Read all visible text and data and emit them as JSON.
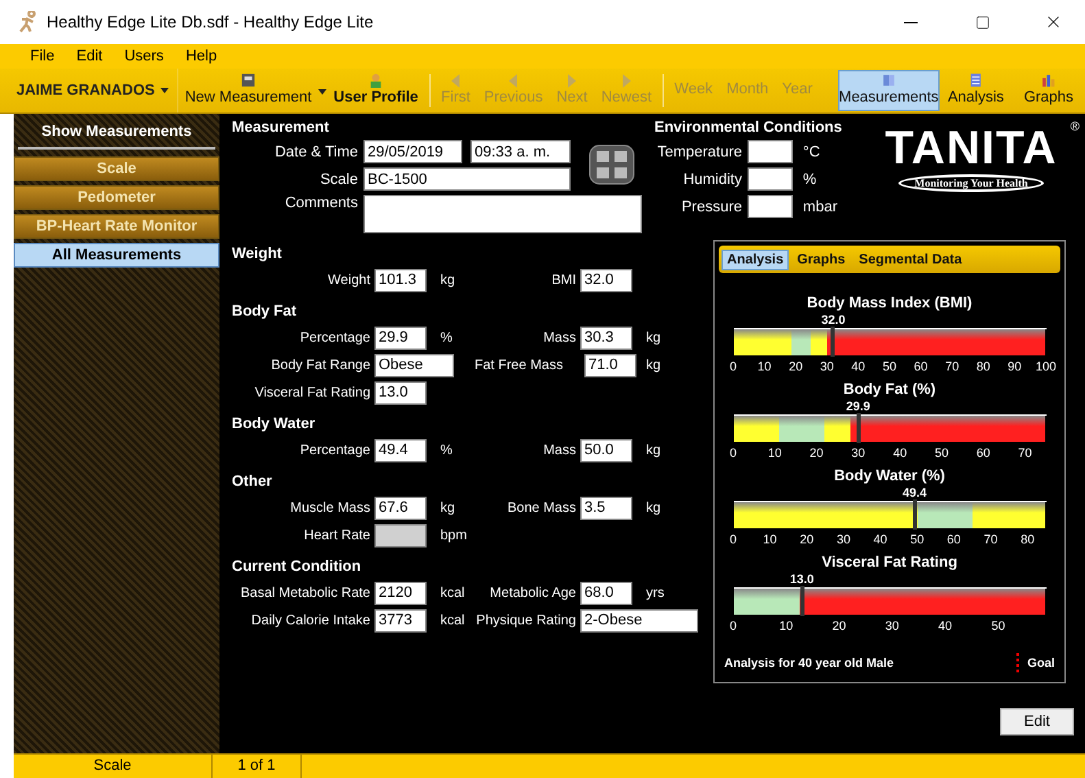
{
  "window": {
    "title": "Healthy Edge Lite Db.sdf - Healthy Edge Lite"
  },
  "menu": [
    "File",
    "Edit",
    "Users",
    "Help"
  ],
  "toolbar": {
    "user": "JAIME GRANADOS",
    "new_measurement": "New Measurement",
    "user_profile": "User Profile",
    "nav": [
      {
        "label": "First",
        "disabled": true
      },
      {
        "label": "Previous",
        "disabled": true
      },
      {
        "label": "Next",
        "disabled": true
      },
      {
        "label": "Newest",
        "disabled": true
      }
    ],
    "periods": [
      {
        "label": "Week",
        "disabled": true
      },
      {
        "label": "Month",
        "disabled": true
      },
      {
        "label": "Year",
        "disabled": true
      }
    ],
    "views": [
      {
        "label": "Measurements",
        "kind": "book",
        "selected": true
      },
      {
        "label": "Analysis",
        "kind": "sheet",
        "selected": false
      },
      {
        "label": "Graphs",
        "kind": "bars",
        "selected": false
      }
    ]
  },
  "sidebar": {
    "title": "Show Measurements",
    "items": [
      {
        "label": "Scale",
        "selected": false
      },
      {
        "label": "Pedometer",
        "selected": false
      },
      {
        "label": "BP-Heart Rate Monitor",
        "selected": false
      },
      {
        "label": "All Measurements",
        "selected": true
      }
    ]
  },
  "measurement": {
    "title": "Measurement",
    "date_label": "Date & Time",
    "date": "29/05/2019",
    "time": "09:33 a. m.",
    "scale_label": "Scale",
    "scale": "BC-1500",
    "comments_label": "Comments"
  },
  "environment": {
    "title": "Environmental Conditions",
    "fields": [
      {
        "label": "Temperature",
        "unit": "°C"
      },
      {
        "label": "Humidity",
        "unit": "%"
      },
      {
        "label": "Pressure",
        "unit": "mbar"
      }
    ]
  },
  "logo": {
    "brand": "TANITA",
    "mark": "®",
    "tagline": "Monitoring Your Health"
  },
  "sections": [
    {
      "title": "Weight",
      "rows": [
        [
          {
            "label": "Weight",
            "value": "101.3",
            "unit": "kg",
            "kind": "text"
          },
          {
            "label": "BMI",
            "value": "32.0",
            "kind": "text"
          }
        ]
      ]
    },
    {
      "title": "Body Fat",
      "rows": [
        [
          {
            "label": "Percentage",
            "value": "29.9",
            "unit": "%",
            "kind": "text"
          },
          {
            "label": "Mass",
            "value": "30.3",
            "unit": "kg",
            "kind": "text"
          }
        ],
        [
          {
            "label": "Body Fat Range",
            "value": "Obese",
            "kind": "wide"
          },
          {
            "label": "Fat Free Mass",
            "value": "71.0",
            "unit": "kg",
            "kind": "text"
          }
        ],
        [
          {
            "label": "Visceral Fat Rating",
            "value": "13.0",
            "kind": "text"
          }
        ]
      ]
    },
    {
      "title": "Body Water",
      "rows": [
        [
          {
            "label": "Percentage",
            "value": "49.4",
            "unit": "%",
            "kind": "text"
          },
          {
            "label": "Mass",
            "value": "50.0",
            "unit": "kg",
            "kind": "text"
          }
        ]
      ]
    },
    {
      "title": "Other",
      "rows": [
        [
          {
            "label": "Muscle Mass",
            "value": "67.6",
            "unit": "kg",
            "kind": "text"
          },
          {
            "label": "Bone Mass",
            "value": "3.5",
            "unit": "kg",
            "kind": "text"
          }
        ],
        [
          {
            "label": "Heart Rate",
            "unit": "bpm",
            "kind": "disabled"
          }
        ]
      ]
    },
    {
      "title": "Current Condition",
      "rows": [
        [
          {
            "label": "Basal Metabolic Rate",
            "value": "2120",
            "unit": "kcal",
            "kind": "text"
          },
          {
            "label": "Metabolic Age",
            "value": "68.0",
            "unit": "yrs",
            "kind": "text"
          }
        ],
        [
          {
            "label": "Daily Calorie Intake",
            "value": "3773",
            "unit": "kcal",
            "kind": "text"
          },
          {
            "label": "Physique Rating",
            "value": "2-Obese",
            "kind": "wide"
          }
        ]
      ]
    }
  ],
  "analysis": {
    "tabs": [
      {
        "label": "Analysis",
        "selected": true
      },
      {
        "label": "Graphs",
        "selected": false
      },
      {
        "label": "Segmental Data",
        "selected": false
      }
    ],
    "gauges": [
      {
        "title": "Body Mass Index (BMI)",
        "kind": "bmi",
        "reading": "32.0",
        "level": 0.32,
        "ticks": [
          "0",
          "10",
          "20",
          "30",
          "40",
          "50",
          "60",
          "70",
          "80",
          "90",
          "100"
        ]
      },
      {
        "title": "Body Fat (%)",
        "kind": "fat",
        "reading": "29.9",
        "level": 0.4,
        "ticks": [
          "0",
          "10",
          "20",
          "30",
          "40",
          "50",
          "60",
          "70"
        ]
      },
      {
        "title": "Body Water (%)",
        "kind": "water",
        "reading": "49.4",
        "level": 0.58,
        "ticks": [
          "0",
          "10",
          "20",
          "30",
          "40",
          "50",
          "60",
          "70",
          "80"
        ]
      },
      {
        "title": "Visceral Fat Rating",
        "kind": "visceral",
        "reading": "13.0",
        "level": 0.22,
        "ticks": [
          "0",
          "10",
          "20",
          "30",
          "40",
          "50"
        ]
      }
    ],
    "footer": "Analysis for 40 year old Male",
    "legend": "Goal"
  },
  "edit_button": "Edit",
  "status_bar": [
    "Scale",
    "1 of 1"
  ]
}
